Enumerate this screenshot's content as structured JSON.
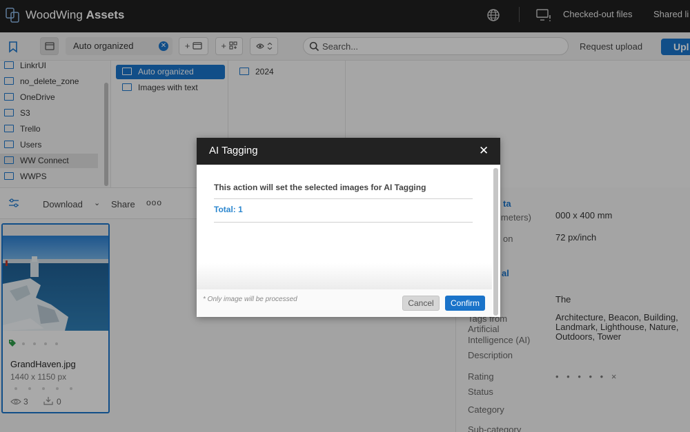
{
  "app": {
    "brand_light": "WoodWing",
    "brand_bold": "Assets",
    "checked_out": "Checked-out files",
    "shared": "Shared li"
  },
  "toolbar": {
    "folder_selected": "Auto organized",
    "new_folder_label": "+",
    "new_collection_label": "+",
    "search_placeholder": "Search...",
    "request_upload": "Request upload",
    "upload": "Upl"
  },
  "folders": {
    "col1": [
      "LinkrUI",
      "no_delete_zone",
      "OneDrive",
      "S3",
      "Trello",
      "Users",
      "WW Connect",
      "WWPS"
    ],
    "col2": [
      "Auto organized",
      "Images with text"
    ],
    "col3": [
      "2024"
    ]
  },
  "actions": {
    "download": "Download",
    "share": "Share",
    "more": "ooo"
  },
  "asset": {
    "filename": "GrandHaven.jpg",
    "dimensions": "1440 x 1150 px",
    "views": "3",
    "downloads": "0"
  },
  "info": {
    "section_meta_partial": "ta",
    "millimeters_partial": "imeters)",
    "millimeters_value_partial": "000 x 400 mm",
    "resolution_partial": "on",
    "resolution_value": "72 px/inch",
    "section_general_partial": "al",
    "title_value": "The",
    "ai_tags_label_lines": [
      "Tags from",
      "Artificial",
      "Intelligence (AI)"
    ],
    "ai_tags_value_lines": [
      "Architecture, Beacon, Building,",
      "Landmark, Lighthouse, Nature,",
      "Outdoors, Tower"
    ],
    "description_label": "Description",
    "rating_label": "Rating",
    "rating_value": "• • • • • ×",
    "status_label": "Status",
    "category_label": "Category",
    "subcategory_label": "Sub-category"
  },
  "modal": {
    "title": "AI Tagging",
    "close": "✕",
    "message": "This action will set the selected images for AI Tagging",
    "total": "Total: 1",
    "note": "* Only image will be processed",
    "cancel": "Cancel",
    "confirm": "Confirm"
  },
  "colors": {
    "accent": "#1a73c9",
    "topbar": "#1f1f1f",
    "modal_header": "#222222"
  }
}
